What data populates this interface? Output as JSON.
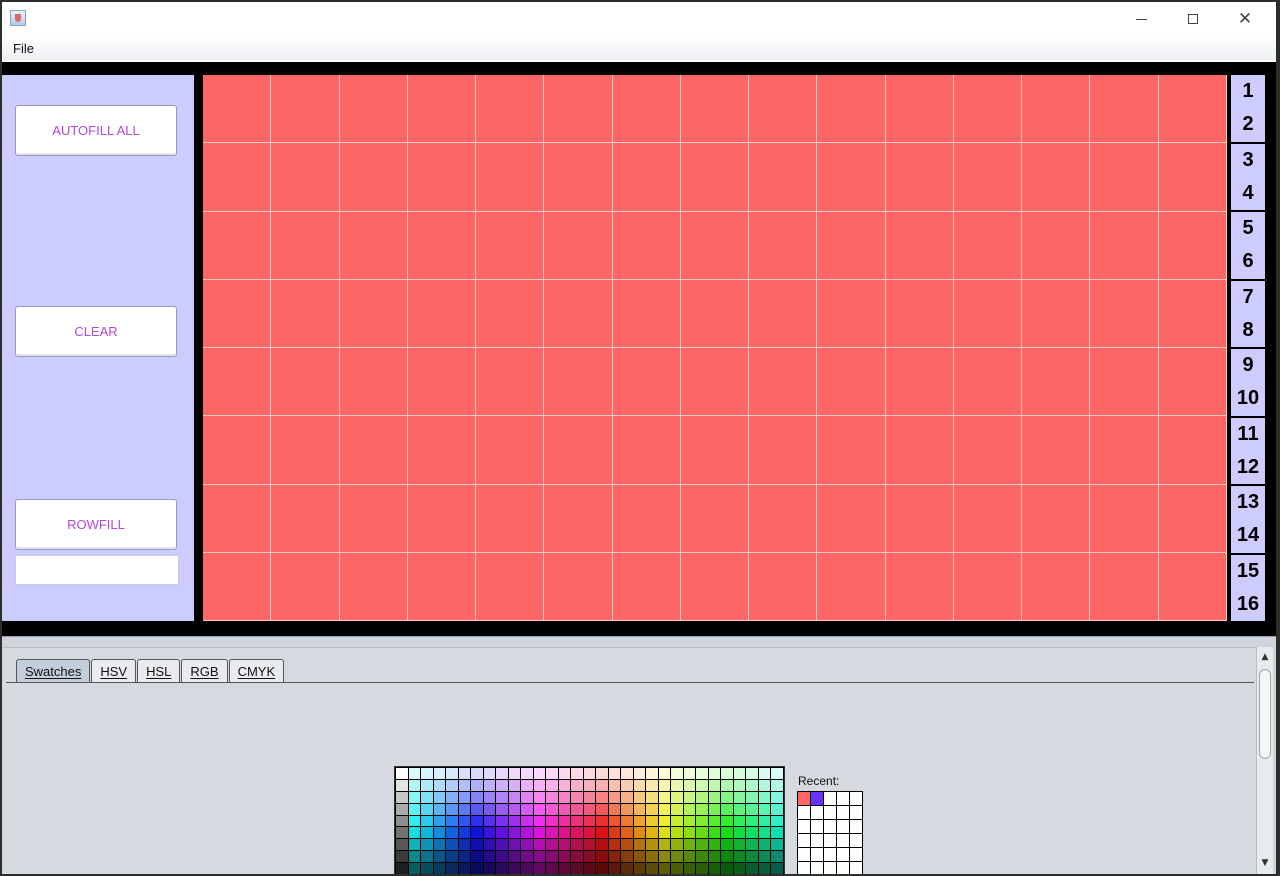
{
  "window": {
    "title": ""
  },
  "titlebar": {
    "minimize_label": "—",
    "maximize_label": "",
    "close_label": "✕"
  },
  "menu": {
    "file": "File"
  },
  "left_panel": {
    "autofill_label": "AUTOFILL ALL",
    "clear_label": "CLEAR",
    "rowfill_label": "ROWFILL",
    "rowfill_value": ""
  },
  "grid": {
    "columns": 15,
    "rows": 8,
    "cell_color": "#ff6666"
  },
  "row_numbers": [
    [
      "1",
      "2"
    ],
    [
      "3",
      "4"
    ],
    [
      "5",
      "6"
    ],
    [
      "7",
      "8"
    ],
    [
      "9",
      "10"
    ],
    [
      "11",
      "12"
    ],
    [
      "13",
      "14"
    ],
    [
      "15",
      "16"
    ]
  ],
  "color_chooser": {
    "tabs": [
      "Swatches",
      "HSV",
      "HSL",
      "RGB",
      "CMYK"
    ],
    "active_tab": "Swatches",
    "recent_label": "Recent:",
    "recent_colors": [
      "#ff6666",
      "#6633ff"
    ]
  },
  "colors": {
    "panel_bg": "#ccccff",
    "button_text": "#b04ad8",
    "grid_fill": "#ff6666"
  }
}
